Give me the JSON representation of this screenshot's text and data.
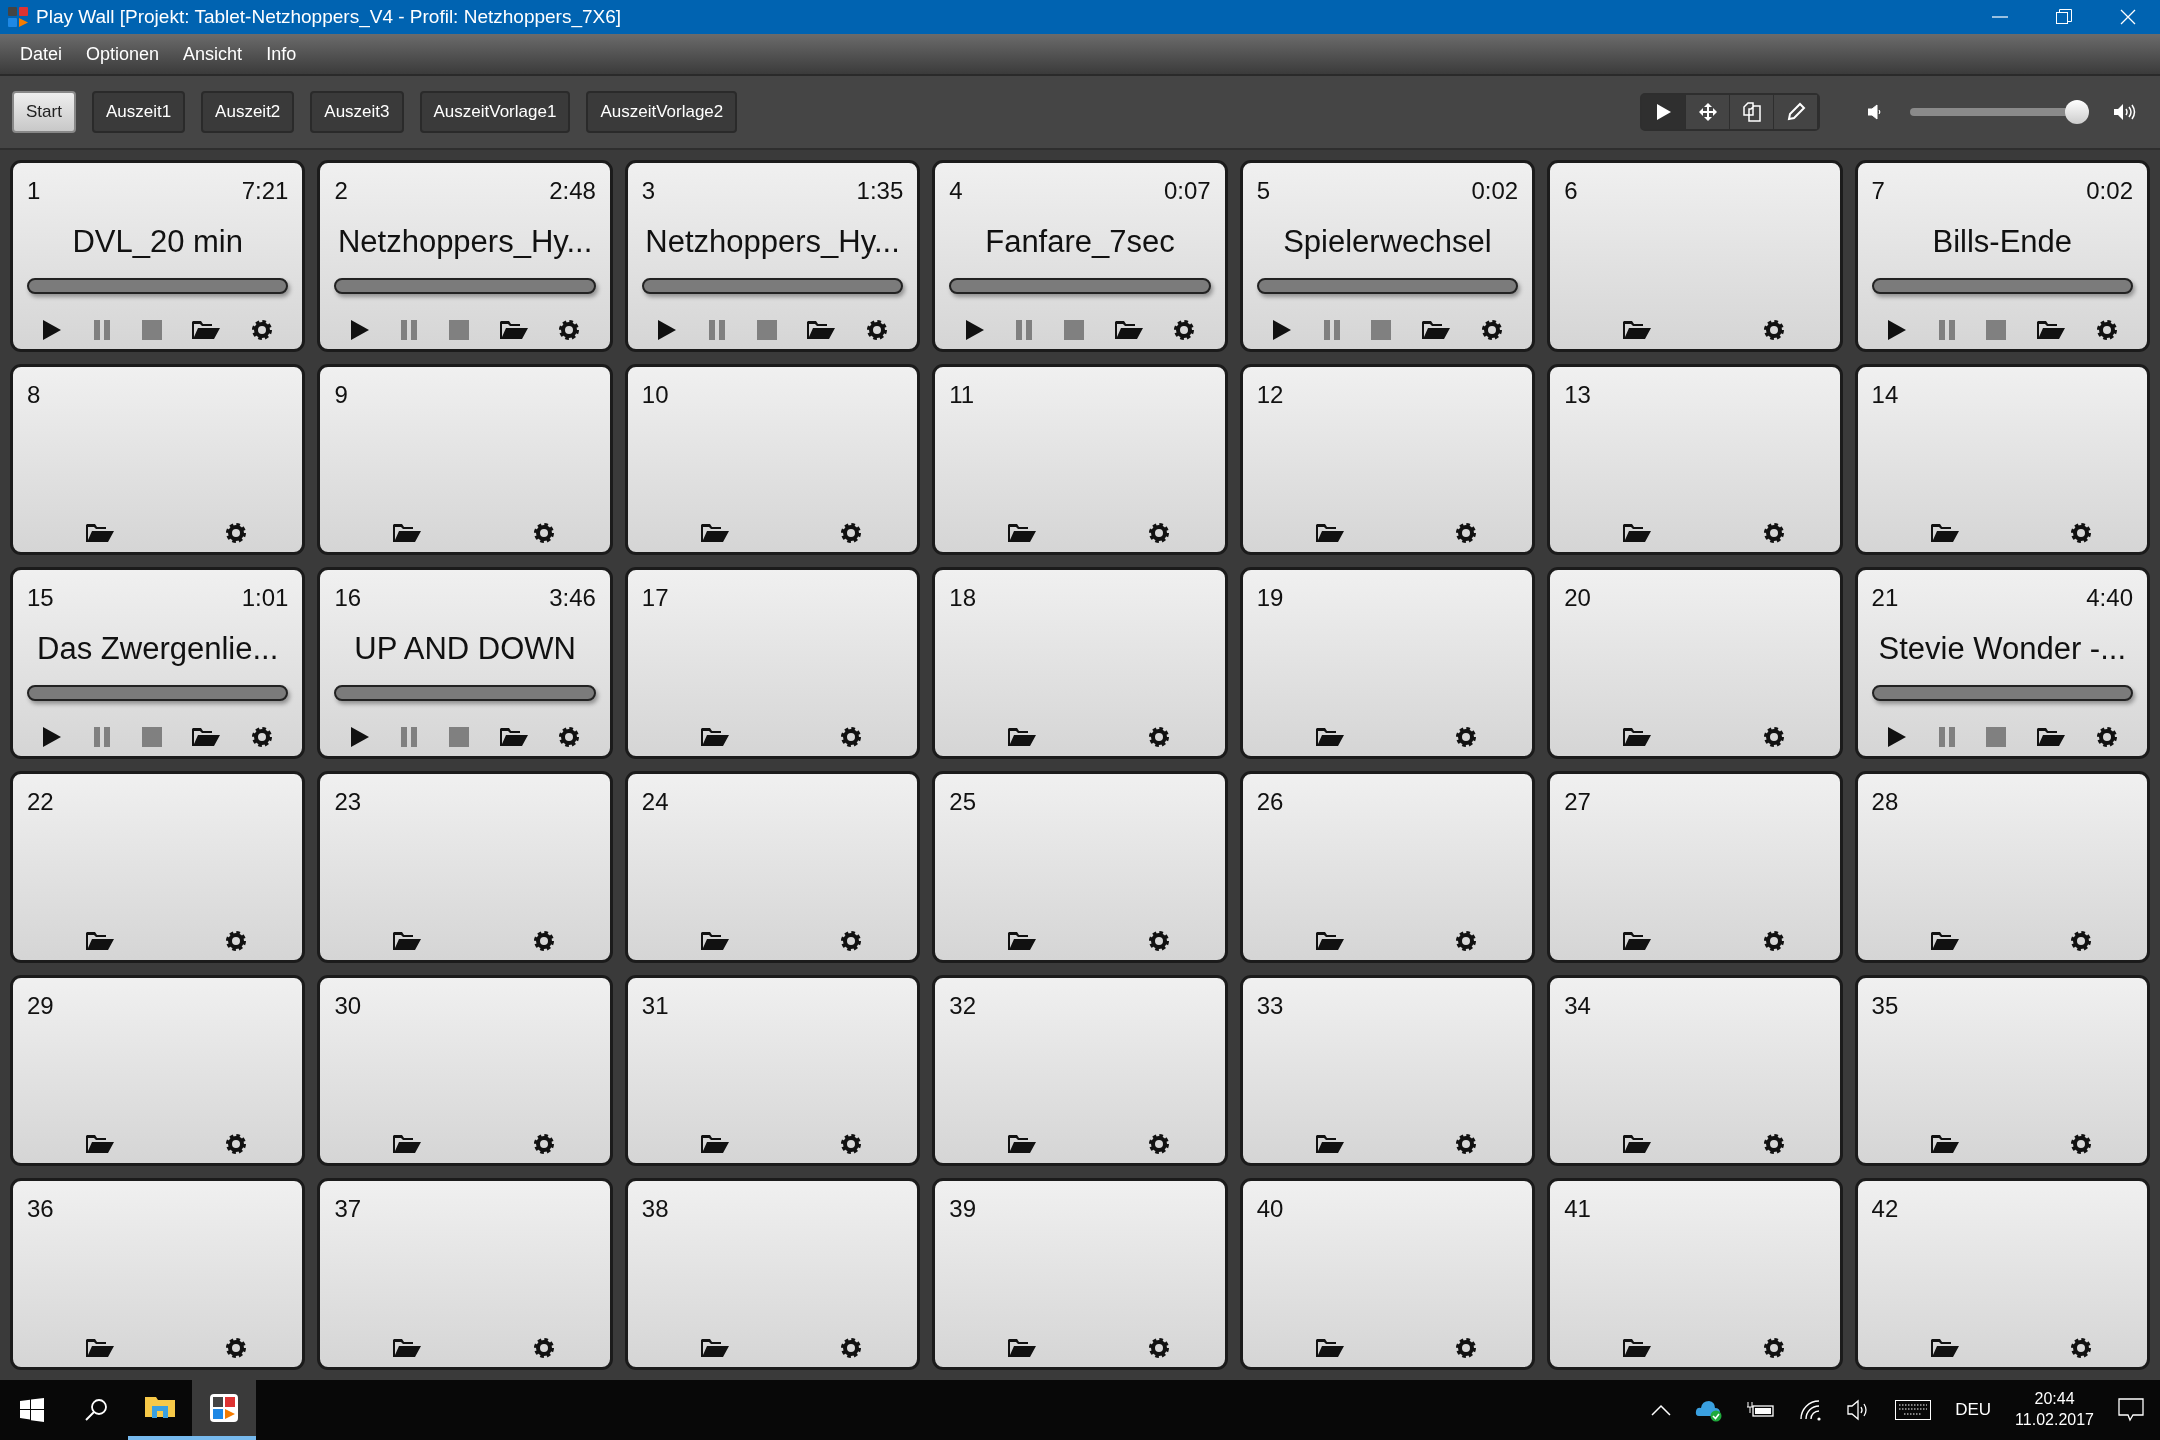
{
  "window": {
    "title": "Play Wall [Projekt: Tablet-Netzhoppers_V4 - Profil: Netzhoppers_7X6]"
  },
  "menu": [
    "Datei",
    "Optionen",
    "Ansicht",
    "Info"
  ],
  "pages": [
    {
      "label": "Start",
      "selected": true
    },
    {
      "label": "Auszeit1",
      "selected": false
    },
    {
      "label": "Auszeit2",
      "selected": false
    },
    {
      "label": "Auszeit3",
      "selected": false
    },
    {
      "label": "AuszeitVorlage1",
      "selected": false
    },
    {
      "label": "AuszeitVorlage2",
      "selected": false
    }
  ],
  "modes": [
    {
      "kind": "play",
      "selected": true
    },
    {
      "kind": "move",
      "selected": false
    },
    {
      "kind": "copy",
      "selected": false
    },
    {
      "kind": "edit",
      "selected": false
    }
  ],
  "volume": {
    "level": 0.95
  },
  "pads": [
    {
      "number": "1",
      "kind": "sound",
      "duration": "7:21",
      "title": "DVL_20 min",
      "level": 0
    },
    {
      "number": "2",
      "kind": "sound",
      "duration": "2:48",
      "title": "Netzhoppers_Hy...",
      "level": 0
    },
    {
      "number": "3",
      "kind": "sound",
      "duration": "1:35",
      "title": "Netzhoppers_Hy...",
      "level": 0
    },
    {
      "number": "4",
      "kind": "sound",
      "duration": "0:07",
      "title": "Fanfare_7sec",
      "level": 0
    },
    {
      "number": "5",
      "kind": "sound",
      "duration": "0:02",
      "title": "Spielerwechsel",
      "level": 0
    },
    {
      "number": "6",
      "kind": "empty"
    },
    {
      "number": "7",
      "kind": "sound",
      "duration": "0:02",
      "title": "Bills-Ende",
      "level": 0
    },
    {
      "number": "8",
      "kind": "empty"
    },
    {
      "number": "9",
      "kind": "empty"
    },
    {
      "number": "10",
      "kind": "empty"
    },
    {
      "number": "11",
      "kind": "empty"
    },
    {
      "number": "12",
      "kind": "empty"
    },
    {
      "number": "13",
      "kind": "empty"
    },
    {
      "number": "14",
      "kind": "empty"
    },
    {
      "number": "15",
      "kind": "sound",
      "duration": "1:01",
      "title": "Das Zwergenlie...",
      "level": 0
    },
    {
      "number": "16",
      "kind": "sound",
      "duration": "3:46",
      "title": "UP AND DOWN",
      "level": 0
    },
    {
      "number": "17",
      "kind": "empty"
    },
    {
      "number": "18",
      "kind": "empty"
    },
    {
      "number": "19",
      "kind": "empty"
    },
    {
      "number": "20",
      "kind": "empty"
    },
    {
      "number": "21",
      "kind": "sound",
      "duration": "4:40",
      "title": "Stevie Wonder -...",
      "level": 0
    },
    {
      "number": "22",
      "kind": "empty"
    },
    {
      "number": "23",
      "kind": "empty"
    },
    {
      "number": "24",
      "kind": "empty"
    },
    {
      "number": "25",
      "kind": "empty"
    },
    {
      "number": "26",
      "kind": "empty"
    },
    {
      "number": "27",
      "kind": "empty"
    },
    {
      "number": "28",
      "kind": "empty"
    },
    {
      "number": "29",
      "kind": "empty"
    },
    {
      "number": "30",
      "kind": "empty"
    },
    {
      "number": "31",
      "kind": "empty"
    },
    {
      "number": "32",
      "kind": "empty"
    },
    {
      "number": "33",
      "kind": "empty"
    },
    {
      "number": "34",
      "kind": "empty"
    },
    {
      "number": "35",
      "kind": "empty"
    },
    {
      "number": "36",
      "kind": "empty"
    },
    {
      "number": "37",
      "kind": "empty"
    },
    {
      "number": "38",
      "kind": "empty"
    },
    {
      "number": "39",
      "kind": "empty"
    },
    {
      "number": "40",
      "kind": "empty"
    },
    {
      "number": "41",
      "kind": "empty"
    },
    {
      "number": "42",
      "kind": "empty"
    }
  ],
  "taskbar": {
    "apps": [
      {
        "kind": "explorer",
        "running": true,
        "selected": false
      },
      {
        "kind": "playwall",
        "running": true,
        "selected": true
      }
    ],
    "language": "DEU",
    "time": "20:44",
    "date": "11.02.2017"
  }
}
